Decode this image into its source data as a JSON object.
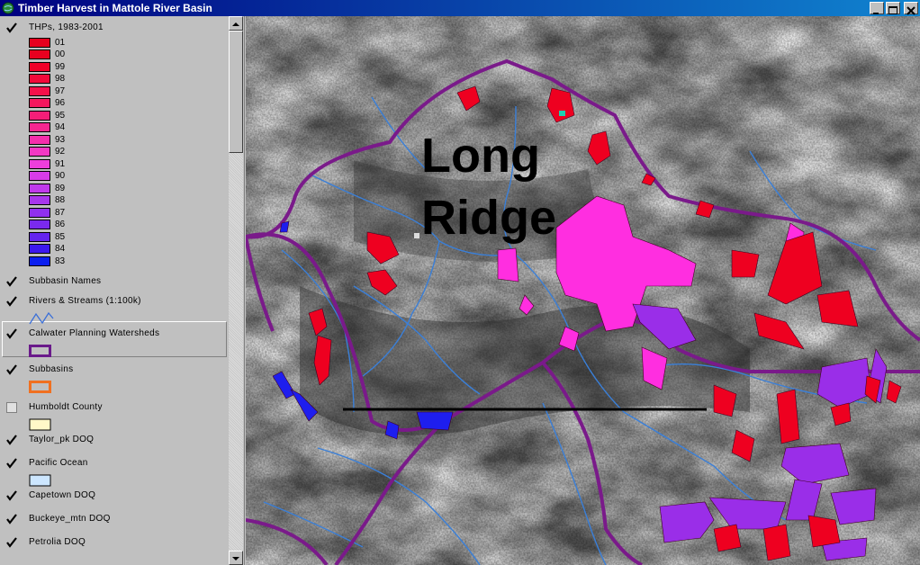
{
  "window": {
    "title": "Timber Harvest in Mattole River Basin",
    "icon": "globe-icon"
  },
  "legend": {
    "thps": {
      "label": "THPs, 1983-2001",
      "checked": true,
      "classes": [
        {
          "label": "01",
          "color": "#e6001e"
        },
        {
          "label": "00",
          "color": "#e8001f"
        },
        {
          "label": "99",
          "color": "#f00028"
        },
        {
          "label": "98",
          "color": "#f20a3a"
        },
        {
          "label": "97",
          "color": "#f5104a"
        },
        {
          "label": "96",
          "color": "#f5165e"
        },
        {
          "label": "95",
          "color": "#f51e78"
        },
        {
          "label": "94",
          "color": "#f52690"
        },
        {
          "label": "93",
          "color": "#f52eac"
        },
        {
          "label": "92",
          "color": "#f238c4"
        },
        {
          "label": "91",
          "color": "#ee3edc"
        },
        {
          "label": "90",
          "color": "#d83ce8"
        },
        {
          "label": "89",
          "color": "#c03aec"
        },
        {
          "label": "88",
          "color": "#a836ee"
        },
        {
          "label": "87",
          "color": "#9030ee"
        },
        {
          "label": "86",
          "color": "#7a2aee"
        },
        {
          "label": "85",
          "color": "#6424ee"
        },
        {
          "label": "84",
          "color": "#3c18ee"
        },
        {
          "label": "83",
          "color": "#0a1ef0"
        }
      ]
    },
    "layers": [
      {
        "label": "Subbasin Names",
        "checked": true
      },
      {
        "label": "Rivers & Streams (1:100k)",
        "checked": true,
        "symbol": "stream-line",
        "color": "#3a6fd8"
      },
      {
        "label": "Calwater Planning Watersheds",
        "checked": true,
        "symbol": "outline-box",
        "color": "#6a1a8a"
      },
      {
        "label": "Subbasins",
        "checked": true,
        "symbol": "outline-box",
        "color": "#f07020"
      },
      {
        "label": "Humboldt County",
        "checked": false,
        "symbol": "fill-box",
        "color": "#fff8c8"
      },
      {
        "label": "Taylor_pk DOQ",
        "checked": true
      },
      {
        "label": "Pacific Ocean",
        "checked": true,
        "symbol": "fill-box",
        "color": "#cce6ff"
      },
      {
        "label": "Capetown DOQ",
        "checked": true
      },
      {
        "label": "Buckeye_mtn DOQ",
        "checked": true
      },
      {
        "label": "Petrolia DOQ",
        "checked": true
      }
    ]
  },
  "map": {
    "label_line1": "Long",
    "label_line2": "Ridge",
    "colors": {
      "watershed": "#7a1a8a",
      "stream": "#3a7fd8",
      "thp_recent": "#ee0020",
      "thp_mid": "#ff2ee0",
      "thp_old": "#9a2ee8",
      "thp_oldest": "#1e1eee"
    }
  }
}
